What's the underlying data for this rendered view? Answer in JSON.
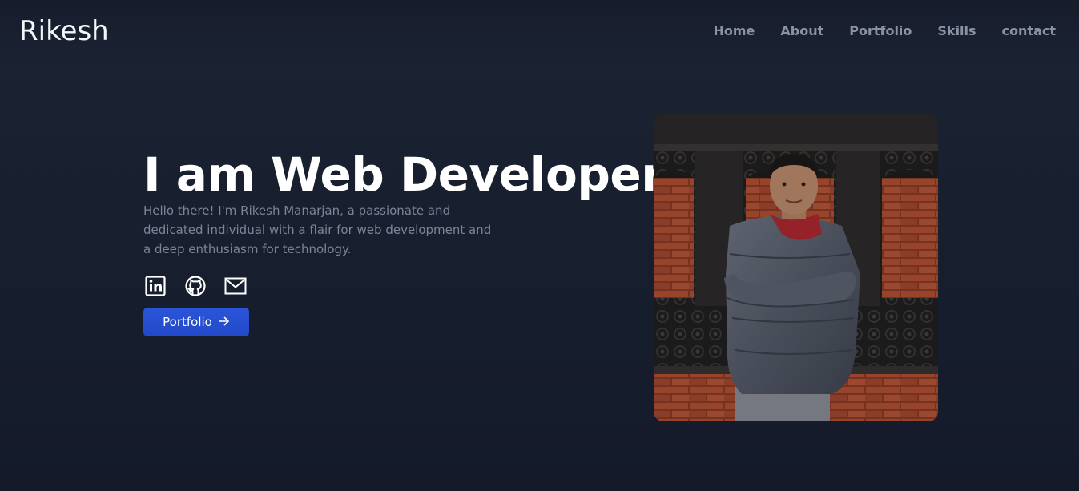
{
  "navbar": {
    "brand": "Rikesh",
    "links": [
      "Home",
      "About",
      "Portfolio",
      "Skills",
      "contact"
    ]
  },
  "hero": {
    "headline": "I am Web Developer",
    "intro": "Hello there! I'm Rikesh Manarjan, a passionate and dedicated individual with a flair for web development and a deep enthusiasm for technology.",
    "socials": [
      "linkedin-icon",
      "github-icon",
      "mail-icon"
    ],
    "cta_label": "Portfolio",
    "cta_icon": "arrow-right-icon"
  },
  "colors": {
    "background": "#182030",
    "headline": "#ffffff",
    "muted_text": "#7c8597",
    "nav_text": "#8a93a5",
    "accent": "#2b55d9"
  }
}
